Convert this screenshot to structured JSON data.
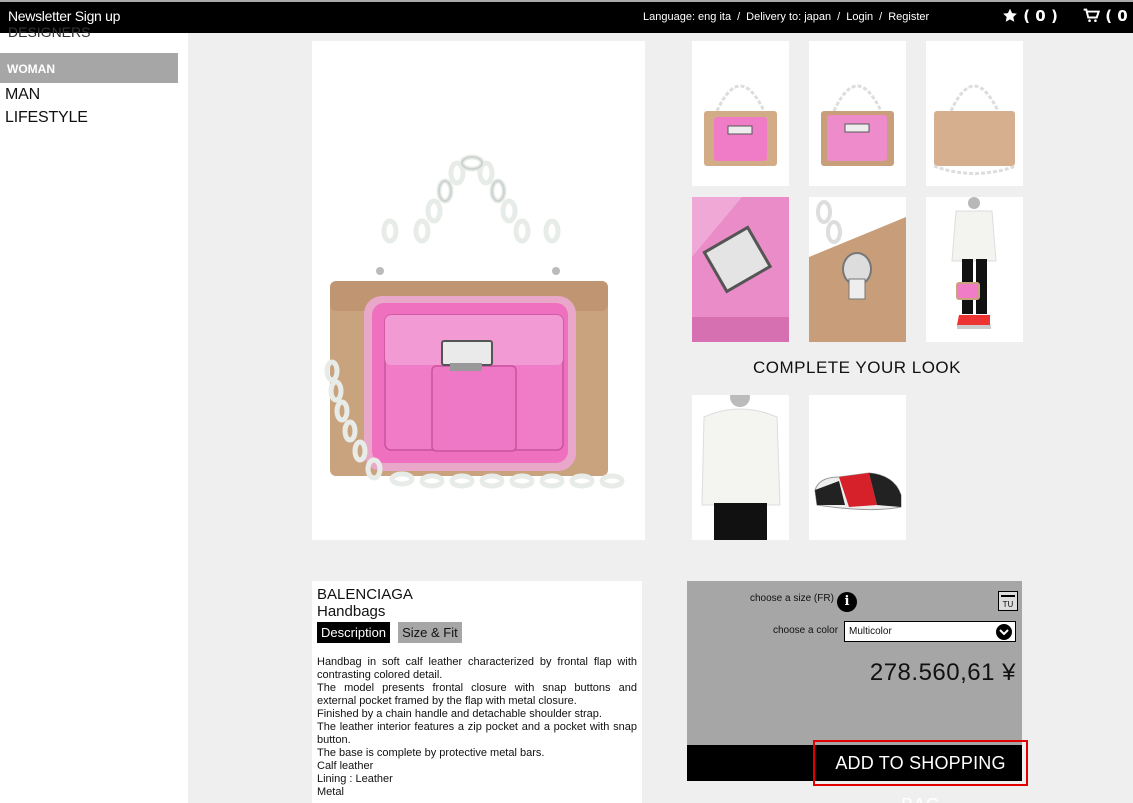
{
  "topbar": {
    "newsletter": "Newsletter Sign up",
    "language": "Language: eng ita",
    "delivery": "Delivery to: japan",
    "login": "Login",
    "register": "Register",
    "separator": "/",
    "wishlist_count": "( 0 )",
    "cart_count": "( 0 )"
  },
  "sidebar": {
    "designers": "DESIGNERS",
    "active": "WOMAN",
    "items": [
      "MAN",
      "LIFESTYLE"
    ]
  },
  "thumbnails": [
    "bag-front",
    "bag-front-2",
    "bag-back",
    "bag-pocket-detail",
    "bag-clasp-detail",
    "model-with-bag"
  ],
  "complete_look": {
    "title": "COMPLETE YOUR LOOK",
    "items": [
      "white-sweater",
      "sneaker"
    ]
  },
  "product": {
    "brand": "BALENCIAGA",
    "category": "Handbags",
    "tabs": [
      "Description",
      "Size & Fit"
    ],
    "description": [
      "Handbag in soft calf leather characterized by frontal flap with contrasting colored detail.",
      "The model presents frontal closure with snap buttons and external pocket framed by the flap with metal closure.",
      "Finished by a chain handle and detachable shoulder strap.",
      "The leather interior features a zip pocket and a pocket with snap button.",
      "The base is complete by protective metal bars.",
      "Calf leather",
      "Lining : Leather",
      "Metal"
    ]
  },
  "purchase": {
    "size_label": "choose a size (FR)",
    "size_value": "TU",
    "color_label": "choose a color",
    "color_value": "Multicolor",
    "price": "278.560,61 ¥",
    "add_button": "ADD TO SHOPPING BAG"
  },
  "colors": {
    "bag_tan": "#c9a27e",
    "bag_pink": "#ee82c2",
    "accent_red": "#e00000"
  }
}
